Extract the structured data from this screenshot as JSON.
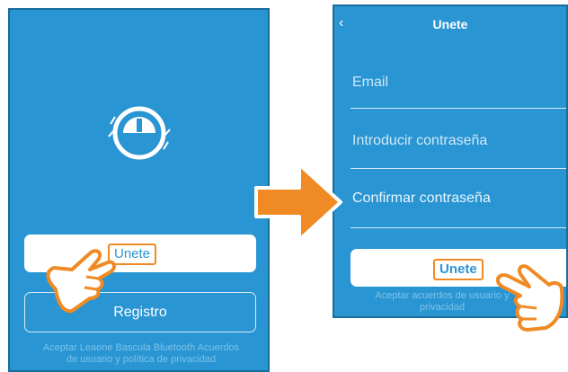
{
  "left_screen": {
    "join_button_label": "Unete",
    "register_button_label": "Registro",
    "terms_text": "Aceptar Leaone Bascula Bluetooth Acuerdos de usuario y política de privacidad",
    "logo_icon": "scale-gauge-icon"
  },
  "right_screen": {
    "title": "Unete",
    "back_icon": "chevron-left-icon",
    "email_placeholder": "Email",
    "password_placeholder": "Introducir contraseña",
    "confirm_password_placeholder": "Confirmar contraseña",
    "join_button_label": "Unete",
    "terms_text": "Aceptar acuerdos de usuario y privacidad"
  },
  "colors": {
    "screen_bg": "#2a95d3",
    "highlight": "#f08a24",
    "button_bg": "#ffffff"
  }
}
